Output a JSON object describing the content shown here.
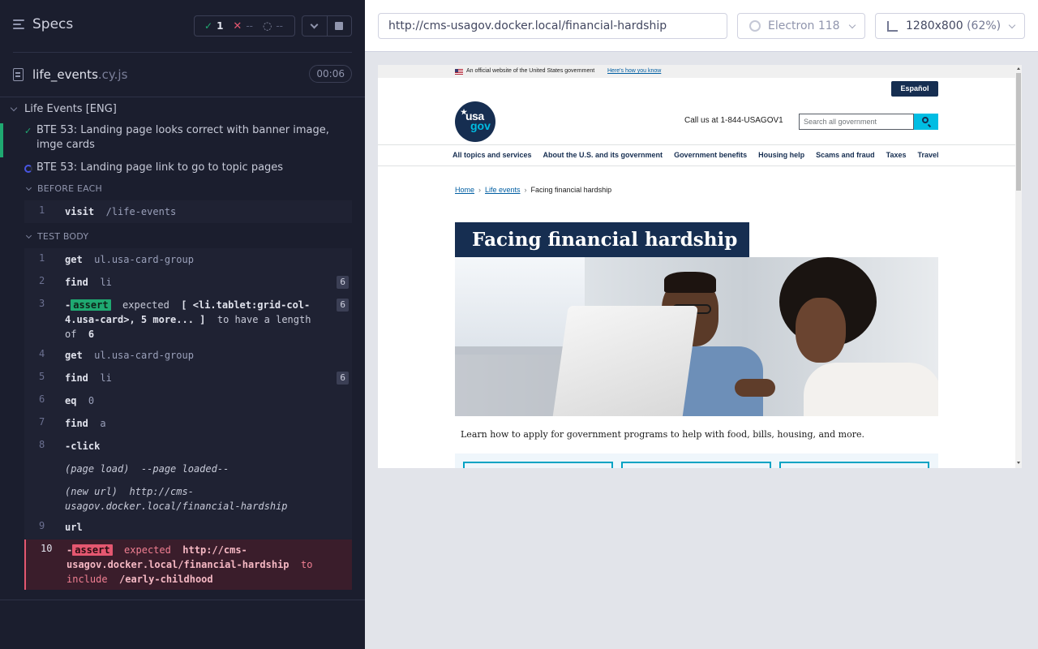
{
  "reporter": {
    "specs_label": "Specs",
    "stats": {
      "passed": "1",
      "failed": "--",
      "pending": "--"
    },
    "file": {
      "name": "life_events",
      "ext": ".cy.js",
      "duration": "00:06"
    },
    "suite": "Life Events [ENG]",
    "tests": [
      {
        "title": "BTE 53: Landing page looks correct with banner image, imge cards",
        "state": "passed"
      },
      {
        "title": "BTE 53: Landing page link to go to topic pages",
        "state": "running"
      }
    ],
    "hooks": {
      "before_each": {
        "title": "BEFORE EACH",
        "commands": [
          {
            "num": "1",
            "name": "visit",
            "arg": "/life-events"
          }
        ]
      },
      "test_body": {
        "title": "TEST BODY",
        "commands": [
          {
            "num": "1",
            "name": "get",
            "arg": "ul.usa-card-group"
          },
          {
            "num": "2",
            "name": "find",
            "arg": "li",
            "badge": "6"
          },
          {
            "num": "3",
            "prefix": "-",
            "pill": "assert",
            "w1": "expected",
            "a1": "[ <li.tablet:grid-col-4.usa-card>, 5 more... ]",
            "w2": "to have a length of",
            "a2": "6",
            "badge": "6"
          },
          {
            "num": "4",
            "name": "get",
            "arg": "ul.usa-card-group"
          },
          {
            "num": "5",
            "name": "find",
            "arg": "li",
            "badge": "6"
          },
          {
            "num": "6",
            "name": "eq",
            "arg": "0"
          },
          {
            "num": "7",
            "name": "find",
            "arg": "a"
          },
          {
            "num": "8",
            "name": "-click",
            "arg": ""
          },
          {
            "event_label": "(page load)",
            "event_value": "--page loaded--"
          },
          {
            "event_label": "(new url)",
            "event_value": "http://cms-usagov.docker.local/financial-hardship"
          },
          {
            "num": "9",
            "name": "url",
            "arg": ""
          },
          {
            "num": "10",
            "prefix": "-",
            "pill": "assert",
            "w1": "expected",
            "a1": "http://cms-usagov.docker.local/financial-hardship",
            "w2": "to include",
            "a2": "/early-childhood",
            "state": "failed"
          }
        ]
      }
    }
  },
  "aut": {
    "url": "http://cms-usagov.docker.local/financial-hardship",
    "browser": "Electron 118",
    "viewport": "1280x800",
    "scale": "(62%)"
  },
  "site": {
    "banner_text": "An official website of the United States government",
    "banner_link": "Here's how you know",
    "espanol": "Español",
    "logo_usa": "usa",
    "logo_gov": "gov",
    "callus": "Call us at 1-844-USAGOV1",
    "search_placeholder": "Search all government",
    "nav": [
      "All topics and services",
      "About the U.S. and its government",
      "Government benefits",
      "Housing help",
      "Scams and fraud",
      "Taxes",
      "Travel"
    ],
    "breadcrumbs": [
      "Home",
      "Life events",
      "Facing financial hardship"
    ],
    "title": "Facing financial hardship",
    "lede": "Learn how to apply for government programs to help with food, bills, housing, and more."
  },
  "colors": {
    "pass": "#1fa971",
    "fail": "#e45770",
    "navy": "#162e51",
    "cyan": "#00bde3"
  }
}
